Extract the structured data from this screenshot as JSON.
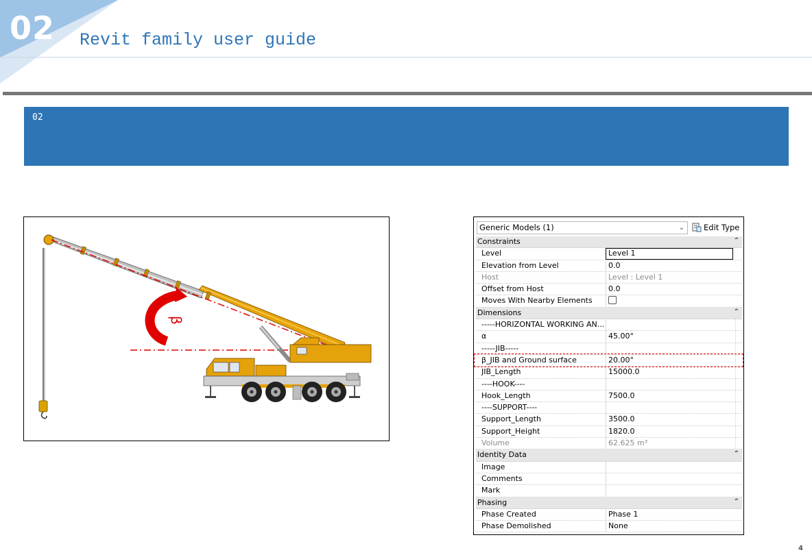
{
  "header": {
    "section_number": "02",
    "title": "Revit family user guide",
    "accent_color": "#9dc3e6",
    "brand_color": "#2e75b6"
  },
  "banner": {
    "label": "02"
  },
  "figure": {
    "angle_symbol": "β",
    "icon": "mobile-crane-illustration"
  },
  "properties": {
    "type_selector": "Generic Models (1)",
    "edit_type_label": "Edit Type",
    "rows": [
      {
        "kind": "group",
        "name": "Constraints"
      },
      {
        "kind": "prop",
        "name": "Level",
        "value": "Level 1",
        "active": true
      },
      {
        "kind": "prop",
        "name": "Elevation from Level",
        "value": "0.0"
      },
      {
        "kind": "prop",
        "name": "Host",
        "value": "Level : Level 1",
        "greyed": true
      },
      {
        "kind": "prop",
        "name": "Offset from Host",
        "value": "0.0"
      },
      {
        "kind": "prop",
        "name": "Moves With Nearby Elements",
        "checkbox": true
      },
      {
        "kind": "group",
        "name": "Dimensions"
      },
      {
        "kind": "prop",
        "name": "-----HORIZONTAL WORKING AN...",
        "value": ""
      },
      {
        "kind": "prop",
        "name": "α",
        "value": "45.00°"
      },
      {
        "kind": "prop",
        "name": "-----JIB-----",
        "value": ""
      },
      {
        "kind": "prop",
        "name": "β_JIB and Ground surface",
        "value": "20.00°"
      },
      {
        "kind": "prop",
        "name": "JIB_Length",
        "value": "15000.0"
      },
      {
        "kind": "prop",
        "name": "----HOOK----",
        "value": ""
      },
      {
        "kind": "prop",
        "name": "Hook_Length",
        "value": "7500.0"
      },
      {
        "kind": "prop",
        "name": "----SUPPORT----",
        "value": ""
      },
      {
        "kind": "prop",
        "name": "Support_Length",
        "value": "3500.0"
      },
      {
        "kind": "prop",
        "name": "Support_Height",
        "value": "1820.0"
      },
      {
        "kind": "prop",
        "name": "Volume",
        "value": "62.625 m³",
        "greyed": true
      },
      {
        "kind": "group",
        "name": "Identity Data"
      },
      {
        "kind": "prop",
        "name": "Image",
        "value": ""
      },
      {
        "kind": "prop",
        "name": "Comments",
        "value": ""
      },
      {
        "kind": "prop",
        "name": "Mark",
        "value": ""
      },
      {
        "kind": "group",
        "name": "Phasing"
      },
      {
        "kind": "prop",
        "name": "Phase Created",
        "value": "Phase 1"
      },
      {
        "kind": "prop",
        "name": "Phase Demolished",
        "value": "None"
      }
    ]
  },
  "footer": {
    "page_number": "4"
  }
}
